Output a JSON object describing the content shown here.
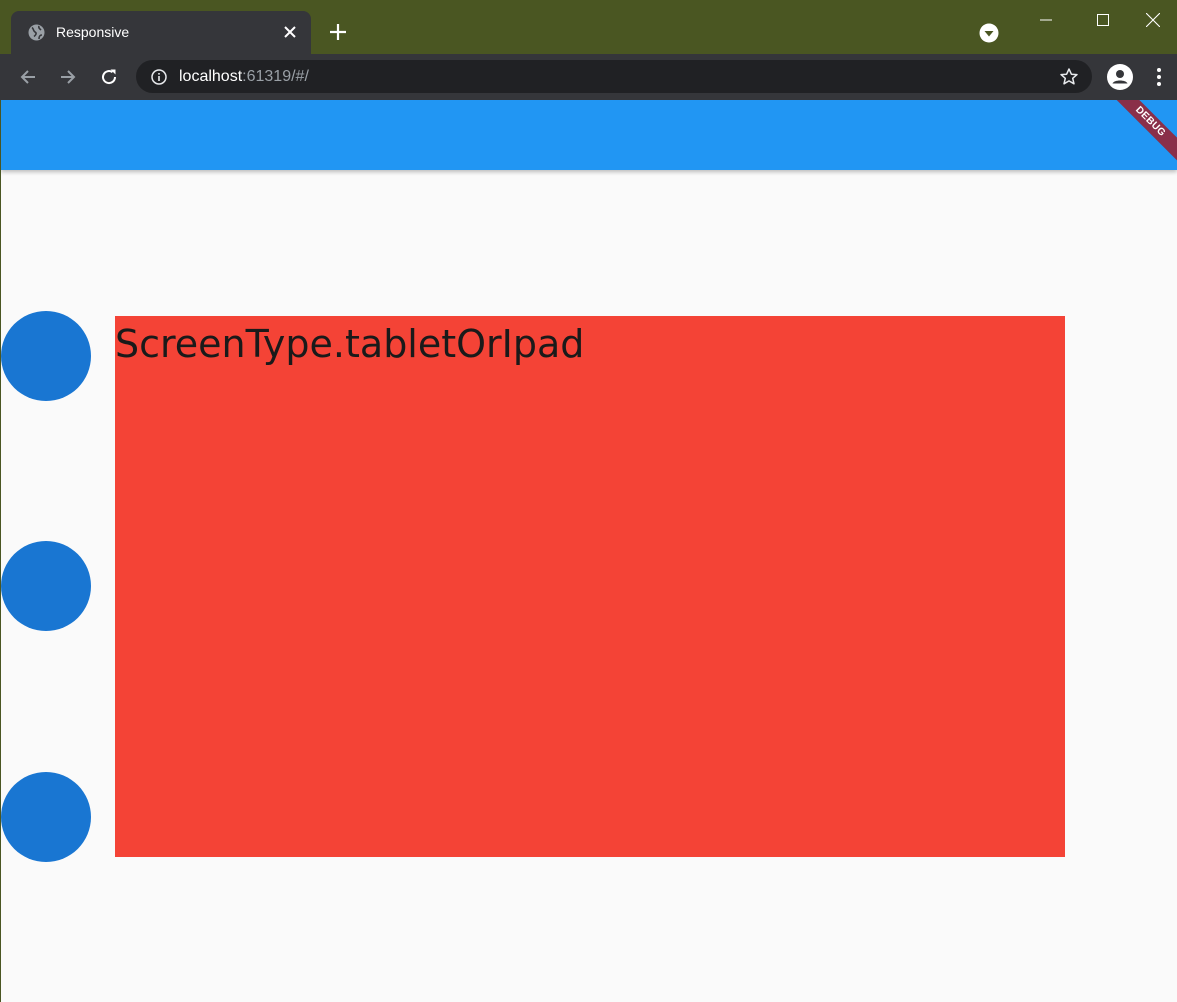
{
  "browser": {
    "tab": {
      "title": "Responsive",
      "icon": "globe-icon"
    },
    "address": {
      "host": "localhost",
      "rest": ":61319/#/"
    },
    "icons": {
      "back": "arrow-left-icon",
      "forward": "arrow-right-icon",
      "reload": "reload-icon",
      "info": "info-icon",
      "bookmark": "star-icon",
      "profile": "avatar-icon",
      "menu": "three-dots-icon"
    }
  },
  "app": {
    "debug_banner": "DEBUG",
    "screen_type": "ScreenType.tabletOrIpad",
    "colors": {
      "appbar": "#2196f3",
      "circles": "#1976d2",
      "box": "#f44336",
      "background": "#fafafa"
    }
  }
}
